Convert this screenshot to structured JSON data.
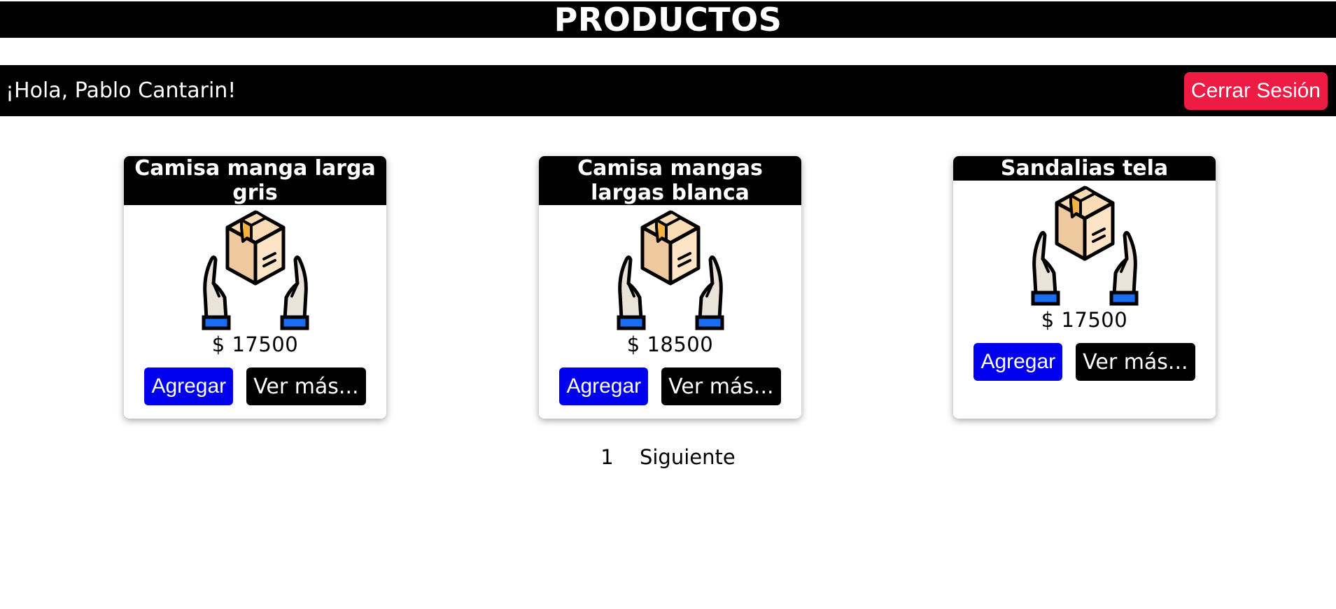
{
  "header": {
    "title": "PRODUCTOS"
  },
  "user_bar": {
    "greeting": "¡Hola, Pablo Cantarin!",
    "logout_label": "Cerrar Sesión"
  },
  "products": [
    {
      "name": "Camisa manga larga gris",
      "price": "$ 17500",
      "add_label": "Agregar",
      "more_label": "Ver más...",
      "icon": "box-in-hands-icon"
    },
    {
      "name": "Camisa mangas largas blanca",
      "price": "$ 18500",
      "add_label": "Agregar",
      "more_label": "Ver más...",
      "icon": "box-in-hands-icon"
    },
    {
      "name": "Sandalias tela",
      "price": "$ 17500",
      "add_label": "Agregar",
      "more_label": "Ver más...",
      "icon": "box-in-hands-icon"
    }
  ],
  "pagination": {
    "current_page": "1",
    "next_label": "Siguiente"
  },
  "colors": {
    "logout": "#ee1c44",
    "add_button": "#0000ee",
    "bars": "#000000"
  }
}
